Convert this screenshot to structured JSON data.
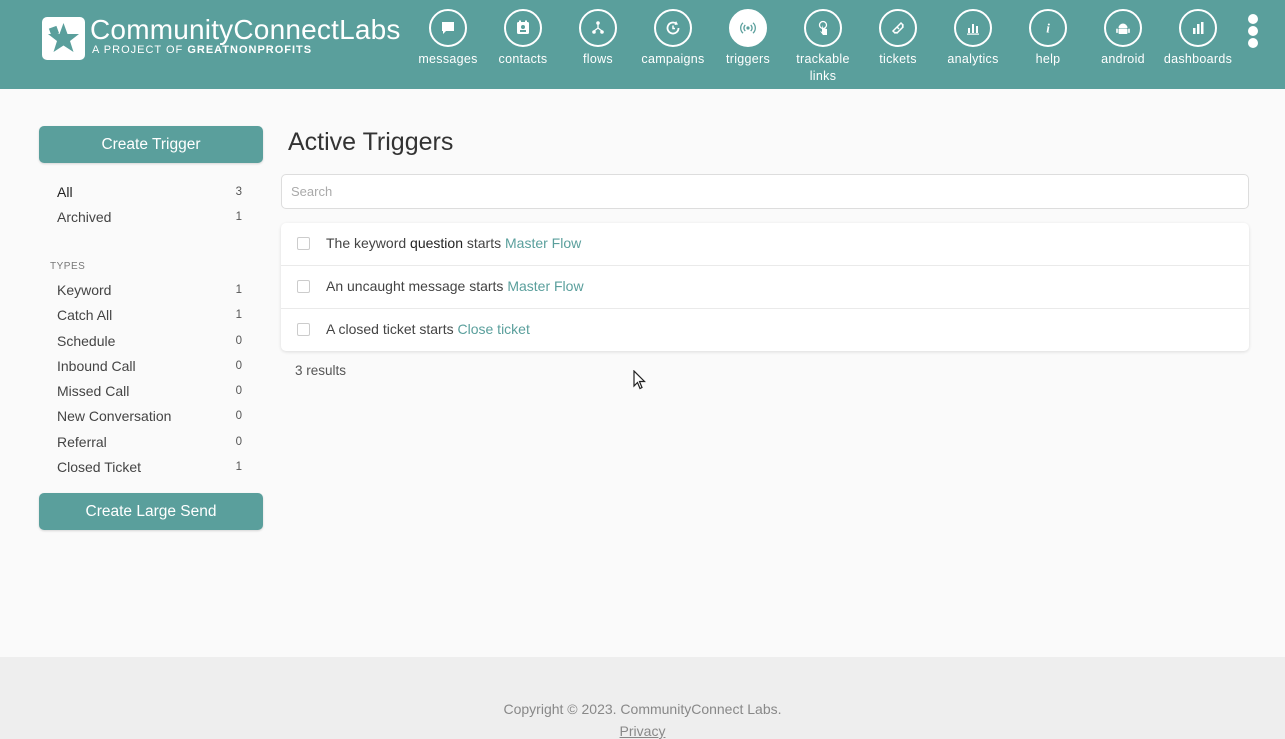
{
  "brand": {
    "name_part1": "CommunityConnect",
    "name_part2": "Labs",
    "tagline_prefix": "A PROJECT OF ",
    "tagline_org": "GREATNONPROFITS"
  },
  "colors": {
    "accent": "#5a9f9c",
    "header_bg": "#5a9f9c",
    "link": "#5a9f9c"
  },
  "nav": [
    {
      "label": "messages",
      "icon": "chat-bubble-icon"
    },
    {
      "label": "contacts",
      "icon": "contact-card-icon"
    },
    {
      "label": "flows",
      "icon": "flow-tree-icon"
    },
    {
      "label": "campaigns",
      "icon": "campaign-clock-icon"
    },
    {
      "label": "triggers",
      "icon": "broadcast-icon",
      "active": true
    },
    {
      "label": "trackable links",
      "icon": "touch-link-icon"
    },
    {
      "label": "tickets",
      "icon": "ticket-icon"
    },
    {
      "label": "analytics",
      "icon": "analytics-chart-icon"
    },
    {
      "label": "help",
      "icon": "info-icon"
    },
    {
      "label": "android",
      "icon": "android-icon"
    },
    {
      "label": "dashboards",
      "icon": "bar-chart-icon"
    }
  ],
  "sidebar": {
    "create_trigger": "Create Trigger",
    "filters": [
      {
        "label": "All",
        "count": "3",
        "selected": true
      },
      {
        "label": "Archived",
        "count": "1"
      }
    ],
    "types_heading": "TYPES",
    "types": [
      {
        "label": "Keyword",
        "count": "1"
      },
      {
        "label": "Catch All",
        "count": "1"
      },
      {
        "label": "Schedule",
        "count": "0"
      },
      {
        "label": "Inbound Call",
        "count": "0"
      },
      {
        "label": "Missed Call",
        "count": "0"
      },
      {
        "label": "New Conversation",
        "count": "0"
      },
      {
        "label": "Referral",
        "count": "0"
      },
      {
        "label": "Closed Ticket",
        "count": "1"
      }
    ],
    "create_large_send": "Create Large Send"
  },
  "main": {
    "title": "Active Triggers",
    "search_placeholder": "Search",
    "triggers": [
      {
        "prefix": "The keyword ",
        "keyword": "question",
        "middle": " starts ",
        "flow": "Master Flow"
      },
      {
        "prefix": "An uncaught message starts ",
        "keyword": "",
        "middle": "",
        "flow": "Master Flow"
      },
      {
        "prefix": "A closed ticket starts ",
        "keyword": "",
        "middle": "",
        "flow": "Close ticket"
      }
    ],
    "results": "3 results"
  },
  "footer": {
    "copyright": "Copyright © 2023. CommunityConnect Labs.",
    "privacy": "Privacy"
  }
}
